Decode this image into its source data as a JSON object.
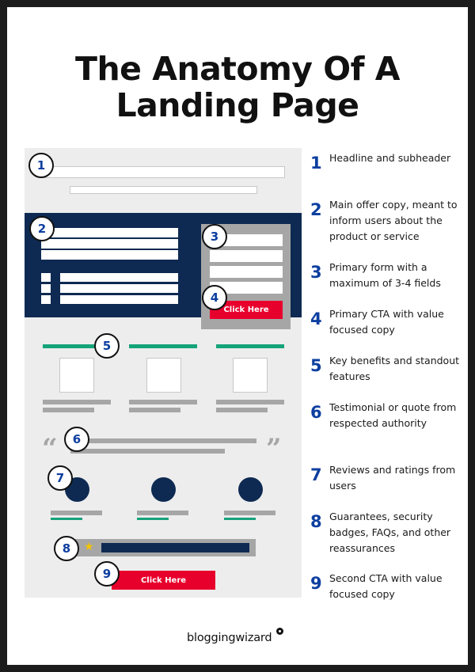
{
  "title": "The Anatomy Of A Landing Page",
  "title_lines": [
    "The Anatomy Of A",
    "Landing Page"
  ],
  "colors": {
    "navy": "#0e2a52",
    "cta_red": "#e8002d",
    "accent_green": "#16a37a",
    "number_blue": "#0d3fa0",
    "mock_bg": "#ededed",
    "gray_bar": "#a6a6a6",
    "star_yellow": "#f5c400"
  },
  "mockup": {
    "markers": [
      "1",
      "2",
      "3",
      "4",
      "5",
      "6",
      "7",
      "8",
      "9"
    ],
    "cta_primary_label": "Click Here",
    "cta_secondary_label": "Click Here",
    "quote_open": "“",
    "quote_close": "”",
    "star_icon": "★"
  },
  "legend": [
    {
      "number": "1",
      "text": "Headline and subheader"
    },
    {
      "number": "2",
      "text": "Main offer copy, meant to inform users about the product or service"
    },
    {
      "number": "3",
      "text": "Primary form with a maximum of 3-4 fields"
    },
    {
      "number": "4",
      "text": "Primary CTA with value focused copy"
    },
    {
      "number": "5",
      "text": "Key benefits and standout features"
    },
    {
      "number": "6",
      "text": "Testimonial or quote from respected authority"
    },
    {
      "number": "7",
      "text": "Reviews and ratings from users"
    },
    {
      "number": "8",
      "text": "Guarantees, security badges, FAQs, and other reassurances"
    },
    {
      "number": "9",
      "text": "Second CTA with value focused copy"
    }
  ],
  "footer": {
    "logo_text": "bloggingwizard"
  }
}
